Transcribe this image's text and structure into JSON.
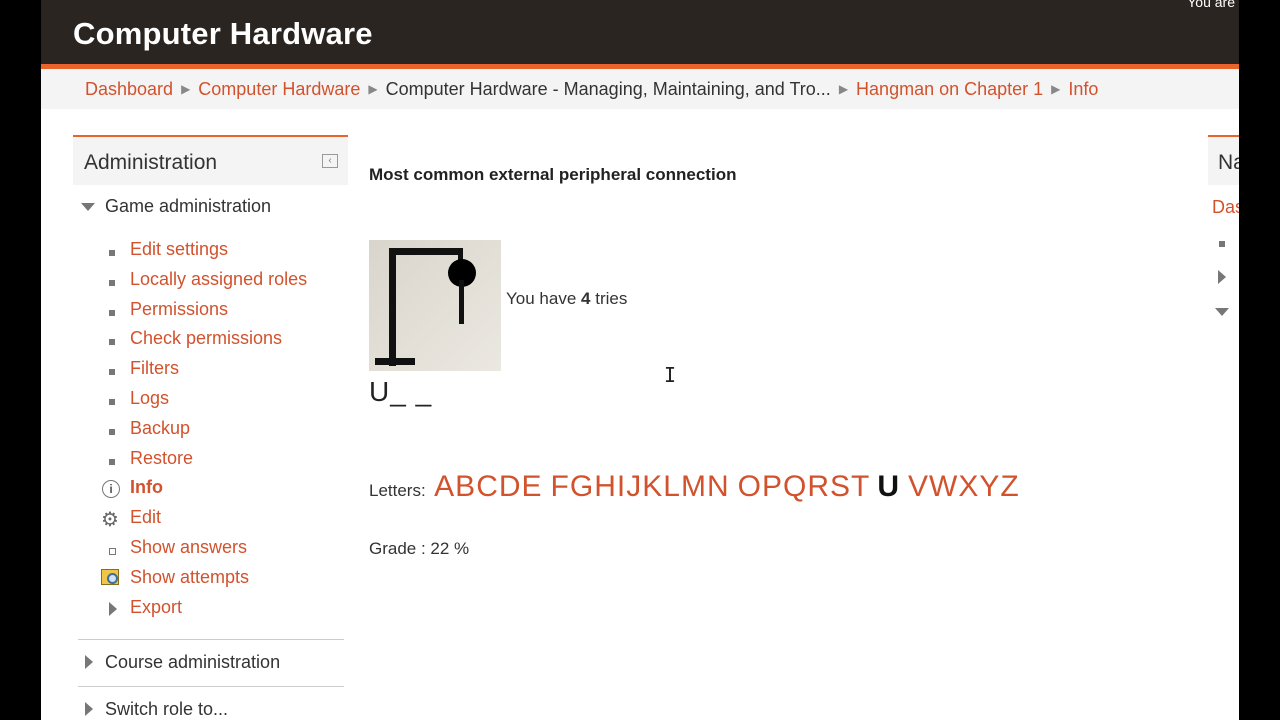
{
  "header": {
    "site_title": "Computer Hardware",
    "login_info": "You are"
  },
  "breadcrumb": [
    {
      "label": "Dashboard",
      "link": true
    },
    {
      "label": "Computer Hardware",
      "link": true
    },
    {
      "label": "Computer Hardware - Managing, Maintaining, and Tro...",
      "link": false
    },
    {
      "label": "Hangman on Chapter 1",
      "link": true
    },
    {
      "label": "Info",
      "link": true
    }
  ],
  "admin": {
    "title": "Administration",
    "game_admin": "Game administration",
    "items": [
      {
        "label": "Edit settings",
        "icon": "square-bullet"
      },
      {
        "label": "Locally assigned roles",
        "icon": "square-bullet"
      },
      {
        "label": "Permissions",
        "icon": "square-bullet"
      },
      {
        "label": "Check permissions",
        "icon": "square-bullet"
      },
      {
        "label": "Filters",
        "icon": "square-bullet"
      },
      {
        "label": "Logs",
        "icon": "square-bullet"
      },
      {
        "label": "Backup",
        "icon": "square-bullet"
      },
      {
        "label": "Restore",
        "icon": "square-bullet"
      },
      {
        "label": "Info",
        "icon": "info-icon"
      },
      {
        "label": "Edit",
        "icon": "gear-icon"
      },
      {
        "label": "Show answers",
        "icon": "square-outline-bullet"
      },
      {
        "label": "Show attempts",
        "icon": "search-report-icon"
      },
      {
        "label": "Export",
        "icon": "chevron-right-icon"
      }
    ],
    "course_admin": "Course administration",
    "switch_role": "Switch role to..."
  },
  "game": {
    "question": "Most common external peripheral connection",
    "tries_prefix": "You have",
    "tries_count": "4",
    "tries_suffix": "tries",
    "word": "U_ _",
    "letters_label": "Letters:",
    "letters": [
      "A",
      "B",
      "C",
      "D",
      "E",
      "F",
      "G",
      "H",
      "I",
      "J",
      "K",
      "L",
      "M",
      "N",
      "O",
      "P",
      "Q",
      "R",
      "S",
      "T",
      "U",
      "V",
      "W",
      "X",
      "Y",
      "Z"
    ],
    "used_letter": "U",
    "grade": "Grade : 22 %"
  },
  "right_block": {
    "title": "Na",
    "link": "Das"
  },
  "colors": {
    "accent": "#e8642c",
    "link": "#d2522d",
    "header_bg": "#2b2521"
  }
}
